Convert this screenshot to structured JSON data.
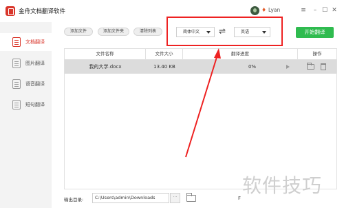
{
  "app": {
    "title": "金舟文档翻译软件"
  },
  "user": {
    "name": "Lyan"
  },
  "window_controls": {
    "menu": "≡",
    "minimize": "–",
    "maximize": "☐",
    "close": "✕"
  },
  "sidebar": {
    "items": [
      {
        "label": "文档翻译",
        "active": true
      },
      {
        "label": "图片翻译",
        "active": false
      },
      {
        "label": "语音翻译",
        "active": false
      },
      {
        "label": "短句翻译",
        "active": false
      }
    ]
  },
  "toolbar": {
    "add_file": "添加文件",
    "add_folder": "添加文件夹",
    "clear_list": "清除列表",
    "source_lang": "简体中文",
    "swap": "⇌",
    "target_lang": "英语",
    "start": "开始翻译"
  },
  "table": {
    "headers": [
      "文件名称",
      "文件大小",
      "翻译进度",
      "操作"
    ],
    "rows": [
      {
        "name": "我的大学.docx",
        "size": "13.40 KB",
        "progress": "0%"
      }
    ]
  },
  "footer": {
    "output_label": "输出目录:",
    "output_path": "C:\\Users\\admin\\Downloads",
    "browse": "···"
  },
  "watermark": "软件技巧",
  "colors": {
    "accent_red": "#d9362b",
    "start_green": "#2fbb4f",
    "annotation_red": "#ee2222"
  }
}
